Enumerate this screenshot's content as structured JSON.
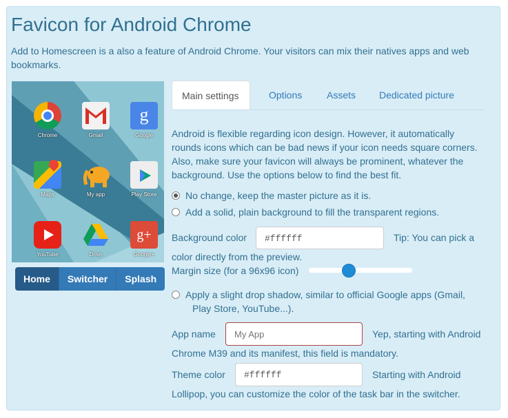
{
  "header": {
    "title": "Favicon for Android Chrome",
    "intro": "Add to Homescreen is a also a feature of Android Chrome. Your visitors can mix their natives apps and web bookmarks."
  },
  "preview": {
    "apps": [
      "Chrome",
      "Gmail",
      "Google",
      "Maps",
      "My app",
      "Play Store",
      "YouTube",
      "Drive",
      "Google+"
    ],
    "modes": [
      "Home",
      "Switcher",
      "Splash"
    ],
    "active_mode": "Home"
  },
  "tabs": [
    "Main settings",
    "Options",
    "Assets",
    "Dedicated picture"
  ],
  "active_tab": "Main settings",
  "main": {
    "description": "Android is flexible regarding icon design. However, it automatically rounds icons which can be bad news if your icon needs square corners. Also, make sure your favicon will always be prominent, whatever the background. Use the options below to find the best fit.",
    "option_no_change": "No change, keep the master picture as it is.",
    "option_solid_bg": "Add a solid, plain background to fill the transparent regions.",
    "bg_color_label": "Background color",
    "bg_color_value": "#ffffff",
    "bg_tip_1": "Tip: You can pick a",
    "bg_tip_2": "color directly from the preview.",
    "margin_label": "Margin size (for a 96x96 icon)",
    "shadow_line1": "Apply a slight drop shadow, similar to official Google apps (Gmail,",
    "shadow_line2": "Play Store, YouTube...).",
    "app_name_label": "App name",
    "app_name_placeholder": "My App",
    "app_name_note_1": "Yep, starting with Android",
    "app_name_note_2": "Chrome M39 and its manifest, this field is mandatory.",
    "theme_color_label": "Theme color",
    "theme_color_value": "#ffffff",
    "theme_note_1": "Starting with Android",
    "theme_note_2": "Lollipop, you can customize the color of the task bar in the switcher."
  }
}
